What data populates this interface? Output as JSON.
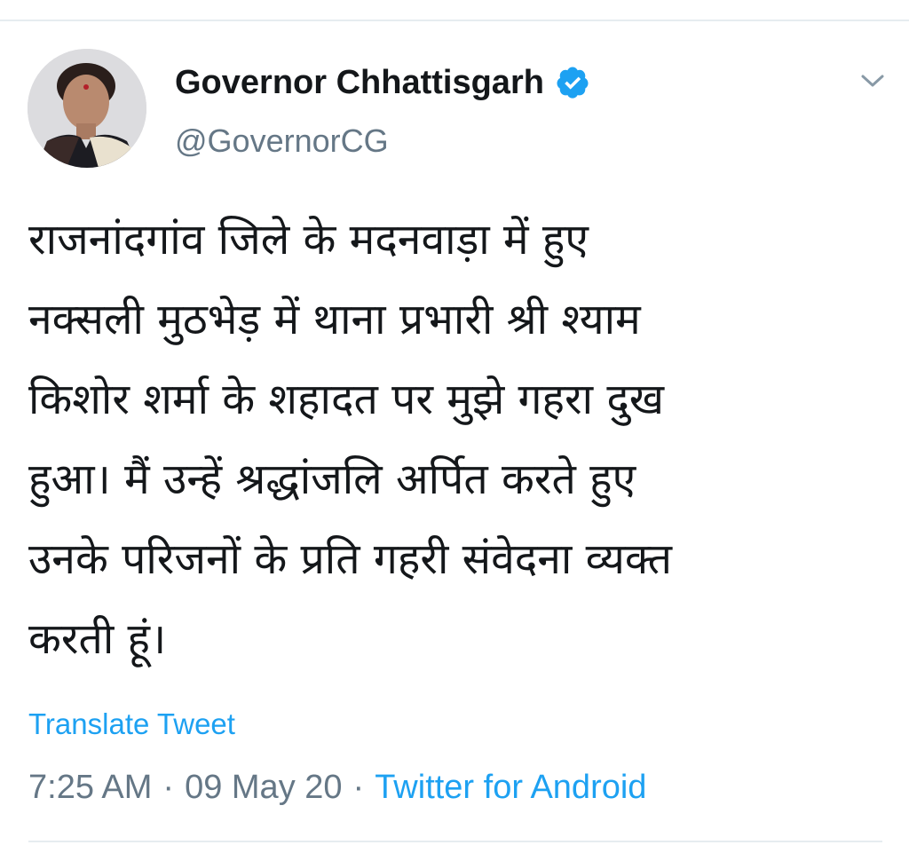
{
  "tweet": {
    "author": {
      "display_name": "Governor Chhattisgarh",
      "handle": "@GovernorCG",
      "verified": true,
      "avatar_icon": "profile-photo",
      "verified_icon": "verified-badge-icon",
      "verified_color": "#1da1f2"
    },
    "menu_icon": "chevron-down-icon",
    "text_lines": [
      "राजनांदगांव जिले के मदनवाड़ा में हुए",
      "नक्सली मुठभेड़ में थाना प्रभारी श्री श्याम",
      "किशोर शर्मा के शहादत पर मुझे गहरा दुख",
      "हुआ। मैं उन्हें श्रद्धांजलि अर्पित करते हुए",
      "उनके परिजनों के प्रति गहरी संवेदना व्यक्त",
      "करती हूं।"
    ],
    "translate_label": "Translate Tweet",
    "meta": {
      "time": "7:25 AM",
      "date": "09 May 20",
      "separator": "·",
      "source": "Twitter for Android"
    }
  },
  "colors": {
    "link": "#1da1f2",
    "secondary_text": "#657786",
    "primary_text": "#14171a",
    "divider": "#e6ecf0"
  }
}
